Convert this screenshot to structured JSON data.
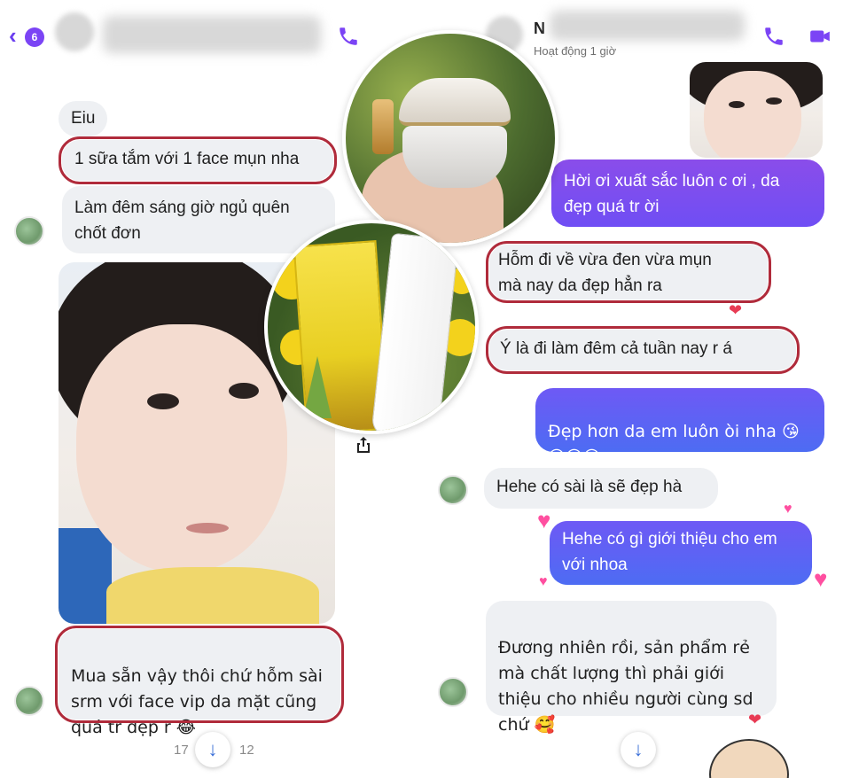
{
  "left": {
    "header": {
      "unread_count": "6"
    },
    "messages": [
      {
        "id": "m1",
        "text": "Eiu"
      },
      {
        "id": "m2",
        "text": "1 sữa tắm với 1 face mụn nha"
      },
      {
        "id": "m3",
        "text": "Làm đêm sáng giờ ngủ quên\nchốt đơn"
      },
      {
        "id": "m4",
        "text": "Mua sẵn vậy thôi chứ hỗm sài\nsrm với face vip da mặt cũng\nquá tr đẹp r 😂"
      }
    ],
    "footer": {
      "left_fragment": "17",
      "right_fragment": "12"
    }
  },
  "right": {
    "header": {
      "name_initial": "N",
      "status": "Hoạt động 1 giờ"
    },
    "messages": [
      {
        "id": "r1",
        "text": "Hời ơi xuất sắc luôn c ơi , da\nđẹp quá tr ời"
      },
      {
        "id": "r2",
        "text": "Hỗm đi về vừa đen vừa mụn\nmà nay da đẹp hẳn ra"
      },
      {
        "id": "r3",
        "text": "Ý là đi làm đêm cả tuần nay r á"
      },
      {
        "id": "r4",
        "text": "Đẹp hơn da em luôn òi nha 😘\n😘😘😄"
      },
      {
        "id": "r5",
        "text": "Hehe có sài là sẽ đẹp hà"
      },
      {
        "id": "r6",
        "text": "Hehe có gì giới thiệu cho em\nvới nhoa"
      },
      {
        "id": "r7",
        "text": "Đương nhiên rồi, sản phẩm rẻ\nmà chất lượng thì phải giới\nthiệu cho nhiều người cùng sd\nchứ 🥰"
      }
    ]
  },
  "colors": {
    "accent": "#7b44f5",
    "highlight_box": "#b02b3b",
    "incoming_bubble": "#eef0f3",
    "outgoing_purple": "#8a4dea",
    "outgoing_blue": "#4d6cf3"
  },
  "icons": [
    "back-icon",
    "call-icon",
    "video-call-icon",
    "share-icon",
    "arrow-down-icon",
    "heart-icon"
  ]
}
